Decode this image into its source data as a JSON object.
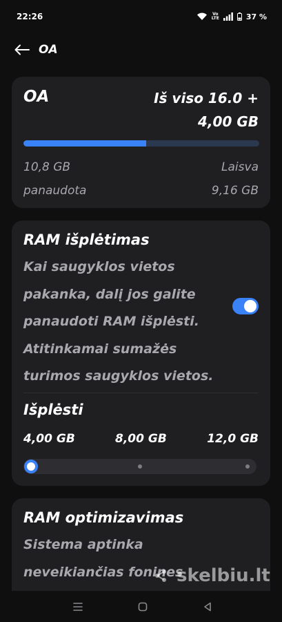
{
  "status_bar": {
    "time": "22:26",
    "volte_top": "Vo",
    "volte_bottom": "LTE",
    "battery": "37 %"
  },
  "header": {
    "title": "OA",
    "back_icon": "arrow-left-icon"
  },
  "storage": {
    "name": "OA",
    "total_line1": "Iš viso 16.0 +",
    "total_line2": "4,00 GB",
    "used_value": "10,8 GB",
    "used_label": "panaudota",
    "free_label": "Laisva",
    "free_value": "9,16 GB",
    "usage_fraction": 0.52,
    "bar_color": "#3a82f7"
  },
  "ram_expansion": {
    "title": "RAM išplėtimas",
    "description": "Kai saugyklos vietos pakanka, dalį jos galite panaudoti RAM išplėsti. Atitinkamai sumažės turimos saugyklos vietos.",
    "toggle_on": true,
    "expand_title": "Išplėsti",
    "options": [
      "4,00 GB",
      "8,00 GB",
      "12,0 GB"
    ],
    "selected_index": 0
  },
  "ram_optimization": {
    "title": "RAM optimizavimas",
    "description": "Sistema aptinka neveikiančias fonines"
  },
  "watermark": {
    "text": "skelbiu.lt"
  },
  "nav_bar": {
    "icons": [
      "menu-icon",
      "home-icon",
      "back-icon"
    ]
  },
  "colors": {
    "accent": "#3a82f7",
    "background": "#0f0f10",
    "card": "#1f1f22",
    "muted_text": "#a8a8ad"
  }
}
